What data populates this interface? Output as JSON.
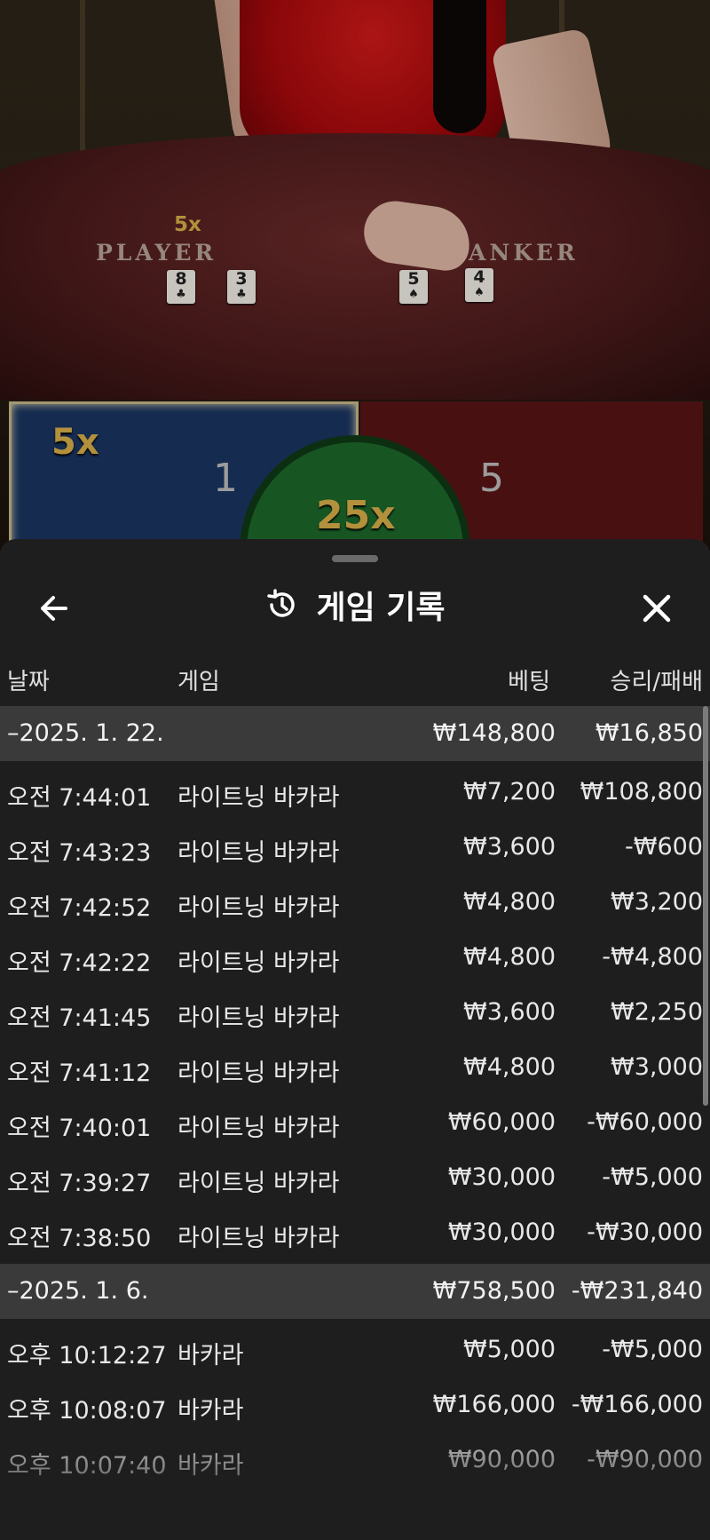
{
  "game_view": {
    "player_label": "PLAYER",
    "banker_label": "ANKER",
    "table_multiplier": "5x",
    "player_cards": [
      {
        "rank": "8",
        "suit": "♣"
      },
      {
        "rank": "3",
        "suit": "♣"
      }
    ],
    "banker_cards": [
      {
        "rank": "5",
        "suit": "♠"
      },
      {
        "rank": "4",
        "suit": "♠"
      }
    ],
    "player_multiplier": "5x",
    "player_score": "1",
    "banker_score": "5",
    "tie_multiplier": "25x"
  },
  "header": {
    "title": "게임 기록",
    "icons": [
      "back-arrow-icon",
      "history-icon",
      "close-icon"
    ]
  },
  "columns": {
    "date": "날짜",
    "game": "게임",
    "bet": "베팅",
    "result": "승리/패배"
  },
  "groups": [
    {
      "date": "–2025. 1. 22.",
      "bet": "₩148,800",
      "result": "₩16,850",
      "rows": [
        {
          "time": "오전 7:44:01",
          "game": "라이트닝 바카라",
          "bet": "₩7,200",
          "result": "₩108,800"
        },
        {
          "time": "오전 7:43:23",
          "game": "라이트닝 바카라",
          "bet": "₩3,600",
          "result": "-₩600"
        },
        {
          "time": "오전 7:42:52",
          "game": "라이트닝 바카라",
          "bet": "₩4,800",
          "result": "₩3,200"
        },
        {
          "time": "오전 7:42:22",
          "game": "라이트닝 바카라",
          "bet": "₩4,800",
          "result": "-₩4,800"
        },
        {
          "time": "오전 7:41:45",
          "game": "라이트닝 바카라",
          "bet": "₩3,600",
          "result": "₩2,250"
        },
        {
          "time": "오전 7:41:12",
          "game": "라이트닝 바카라",
          "bet": "₩4,800",
          "result": "₩3,000"
        },
        {
          "time": "오전 7:40:01",
          "game": "라이트닝 바카라",
          "bet": "₩60,000",
          "result": "-₩60,000"
        },
        {
          "time": "오전 7:39:27",
          "game": "라이트닝 바카라",
          "bet": "₩30,000",
          "result": "-₩5,000"
        },
        {
          "time": "오전 7:38:50",
          "game": "라이트닝 바카라",
          "bet": "₩30,000",
          "result": "-₩30,000"
        }
      ]
    },
    {
      "date": "–2025. 1. 6.",
      "bet": "₩758,500",
      "result": "-₩231,840",
      "rows": [
        {
          "time": "오후 10:12:27",
          "game": "바카라",
          "bet": "₩5,000",
          "result": "-₩5,000"
        },
        {
          "time": "오후 10:08:07",
          "game": "바카라",
          "bet": "₩166,000",
          "result": "-₩166,000"
        },
        {
          "time": "오후 10:07:40",
          "game": "바카라",
          "bet": "₩90,000",
          "result": "-₩90,000"
        }
      ]
    }
  ],
  "colors": {
    "sheet_bg": "#1e1e1e",
    "group_row_bg": "#3a3a3a",
    "text": "#e8e8e8",
    "multiplier_gold": "#d9b04a"
  }
}
